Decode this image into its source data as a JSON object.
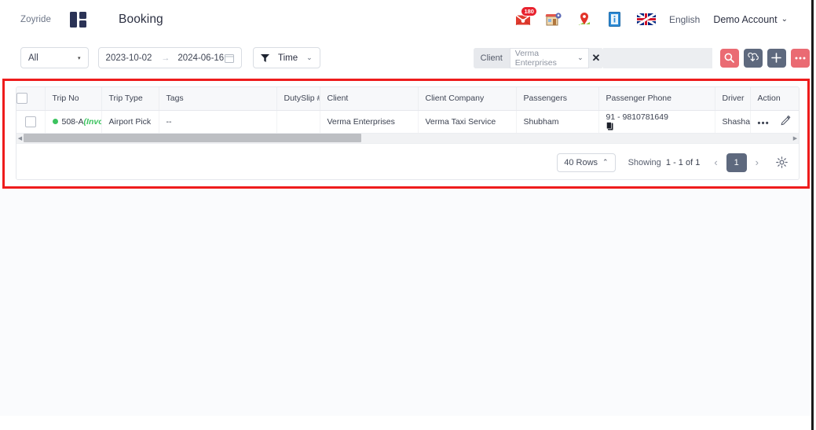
{
  "topnav": {
    "brand": "Zoyride",
    "logo_icon": "grid-logo-icon",
    "page_title": "Booking",
    "icons": [
      {
        "name": "mail-icon",
        "glyph": "mail",
        "badge": "180"
      },
      {
        "name": "store-icon",
        "glyph": "store"
      },
      {
        "name": "map-pin-icon",
        "glyph": "pin"
      },
      {
        "name": "book-info-icon",
        "glyph": "book"
      }
    ],
    "flag_icon": "uk-flag-icon",
    "language": "English",
    "account": "Demo Account",
    "account_caret": "⌄"
  },
  "filters": {
    "status_select": "All",
    "status_caret": "▾",
    "date_from": "2023-10-02",
    "date_arrow": "→",
    "date_to": "2024-06-16",
    "calendar_icon": "calendar-icon",
    "time_filter_icon": "funnel-icon",
    "time_filter_label": "Time",
    "time_filter_caret": "⌄",
    "client_label": "Client",
    "client_value": "Verma Enterprises",
    "client_caret": "⌄",
    "clear_icon": "✕",
    "buttons": [
      {
        "name": "search-button",
        "icon": "search-icon",
        "color": "#ea6b73"
      },
      {
        "name": "download-button",
        "icon": "download-cloud-icon",
        "color": "#5e697e"
      },
      {
        "name": "add-button",
        "icon": "plus-icon",
        "color": "#5e697e"
      },
      {
        "name": "more-options-button",
        "icon": "ellipsis-icon",
        "color": "#ea6b73"
      }
    ]
  },
  "table": {
    "columns": [
      "Trip No",
      "Trip Type",
      "Tags",
      "DutySlip #",
      "Client",
      "Client Company",
      "Passengers",
      "Passenger Phone",
      "Driver",
      "Action"
    ],
    "rows": [
      {
        "status_dot_color": "#3cc35f",
        "trip_no": "508-A",
        "trip_status": "(Invoiced",
        "trip_type": "Airport Pick",
        "tags": "--",
        "dutyslip": "",
        "client": "Verma Enterprises",
        "client_company": "Verma Taxi Service",
        "passengers": "Shubham",
        "passenger_phone": "91 - 9810781649",
        "copy_icon": "clipboard-icon",
        "driver": "Shashank",
        "action_more": "•••",
        "action_edit": "edit-pencil-icon"
      }
    ]
  },
  "pager": {
    "rows_per_page": "40 Rows",
    "rows_caret": "⌃",
    "showing_label": "Showing",
    "showing_range": "1 - 1 of 1",
    "prev_icon": "‹",
    "current_page": "1",
    "next_icon": "›",
    "settings_icon": "gear-icon"
  },
  "colors": {
    "highlight_border": "#ee1c1c",
    "accent_red": "#ea6b73",
    "accent_slate": "#5e697e",
    "status_green": "#3cc35f"
  }
}
